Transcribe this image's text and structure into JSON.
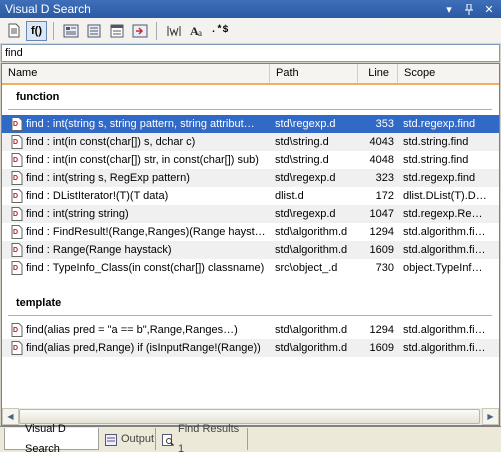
{
  "window": {
    "title": "Visual D Search",
    "dropdown_glyph": "▾",
    "pin_glyph": "📌",
    "close_glyph": "✕"
  },
  "toolbar": {
    "buttons": [
      {
        "name": "document-icon",
        "label": ""
      },
      {
        "name": "function-filter-icon",
        "label": "f()"
      },
      {
        "name": "sort-icon",
        "label": ""
      },
      {
        "name": "list-icon",
        "label": ""
      },
      {
        "name": "columns-icon",
        "label": ""
      },
      {
        "name": "jump-icon",
        "label": ""
      },
      {
        "name": "whole-word-icon",
        "label": ""
      },
      {
        "name": "match-case-icon",
        "label": ""
      },
      {
        "name": "regex-icon",
        "label": ".*$"
      }
    ]
  },
  "search": {
    "value": "find",
    "placeholder": ""
  },
  "columns": {
    "name": "Name",
    "path": "Path",
    "line": "Line",
    "scope": "Scope"
  },
  "groups": [
    {
      "label": "function",
      "rows": [
        {
          "name": "find : int(string s, string pattern, string attribut…",
          "path": "std\\regexp.d",
          "line": "353",
          "scope": "std.regexp.find",
          "selected": true
        },
        {
          "name": "find : int(in const(char[]) s, dchar c)",
          "path": "std\\string.d",
          "line": "4043",
          "scope": "std.string.find"
        },
        {
          "name": "find : int(in const(char[]) str, in const(char[]) sub)",
          "path": "std\\string.d",
          "line": "4048",
          "scope": "std.string.find"
        },
        {
          "name": "find : int(string s, RegExp pattern)",
          "path": "std\\regexp.d",
          "line": "323",
          "scope": "std.regexp.find"
        },
        {
          "name": "find : DListIterator!(T)(T data)",
          "path": "dlist.d",
          "line": "172",
          "scope": "dlist.DList(T).DL…"
        },
        {
          "name": "find : int(string string)",
          "path": "std\\regexp.d",
          "line": "1047",
          "scope": "std.regexp.Reg…"
        },
        {
          "name": "find : FindResult!(Range,Ranges)(Range hayst…",
          "path": "std\\algorithm.d",
          "line": "1294",
          "scope": "std.algorithm.fi…"
        },
        {
          "name": "find : Range(Range haystack)",
          "path": "std\\algorithm.d",
          "line": "1609",
          "scope": "std.algorithm.fi…"
        },
        {
          "name": "find : TypeInfo_Class(in const(char[]) classname)",
          "path": "src\\object_.d",
          "line": "730",
          "scope": "object.TypeInf…"
        }
      ]
    },
    {
      "label": "template",
      "rows": [
        {
          "name": "find(alias pred = \"a == b\",Range,Ranges…)",
          "path": "std\\algorithm.d",
          "line": "1294",
          "scope": "std.algorithm.fi…"
        },
        {
          "name": "find(alias pred,Range) if (isInputRange!(Range))",
          "path": "std\\algorithm.d",
          "line": "1609",
          "scope": "std.algorithm.fi…"
        }
      ]
    }
  ],
  "tabs": [
    {
      "label": "Visual D Search",
      "active": true
    },
    {
      "label": "Output",
      "active": false
    },
    {
      "label": "Find Results 1",
      "active": false
    }
  ],
  "colors": {
    "selection": "#3169c6",
    "title_bar": "#2b5aa6",
    "header_underline": "#f0b060"
  }
}
